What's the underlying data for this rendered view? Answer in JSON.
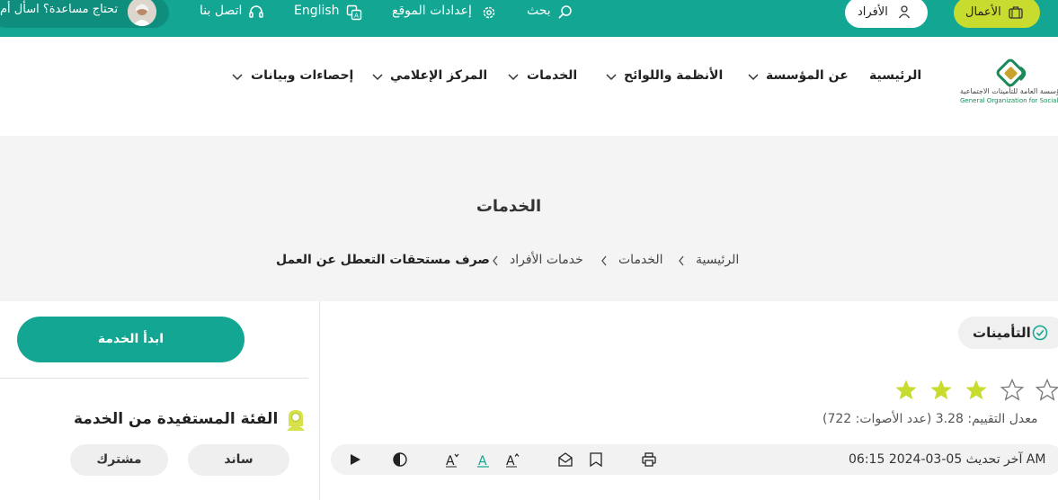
{
  "topbar": {
    "help_text": "تحتاج مساعدة؟ اسأل أم",
    "contact": "اتصل بنا",
    "language": "English",
    "settings": "إعدادات الموقع",
    "search": "بحث",
    "individuals": "الأفراد",
    "business": "الأعمال"
  },
  "logo": {
    "ar": "المؤسسة العامة للتأمينات الاجتماعية",
    "en": "General Organization for Social Insurance"
  },
  "nav": [
    "الرئيسية",
    "عن المؤسسة",
    "الأنظمة واللوائح",
    "الخدمات",
    "المركز الإعلامي",
    "إحصاءات وبيانات"
  ],
  "banner": {
    "title": "الخدمات",
    "breadcrumb": [
      "الرئيسية",
      "الخدمات",
      "خدمات الأفراد",
      "صرف مستحقات التعطل عن العمل"
    ]
  },
  "sidebar": {
    "start_button": "ابدأ الخدمة",
    "beneficiary_title": "الفئة المستفيدة من الخدمة",
    "tags": [
      "ساند",
      "مشترك"
    ]
  },
  "main": {
    "category": "التأمينات",
    "rating": {
      "stars_filled": 3,
      "stars_total": 5,
      "text": "معدل التقييم: 3.28 (عدد الأصوات: 722)"
    },
    "updated": "آخر تحديث 05-03-2024 06:15 AM"
  },
  "colors": {
    "primary": "#13a693",
    "accent": "#c8dc2f"
  }
}
